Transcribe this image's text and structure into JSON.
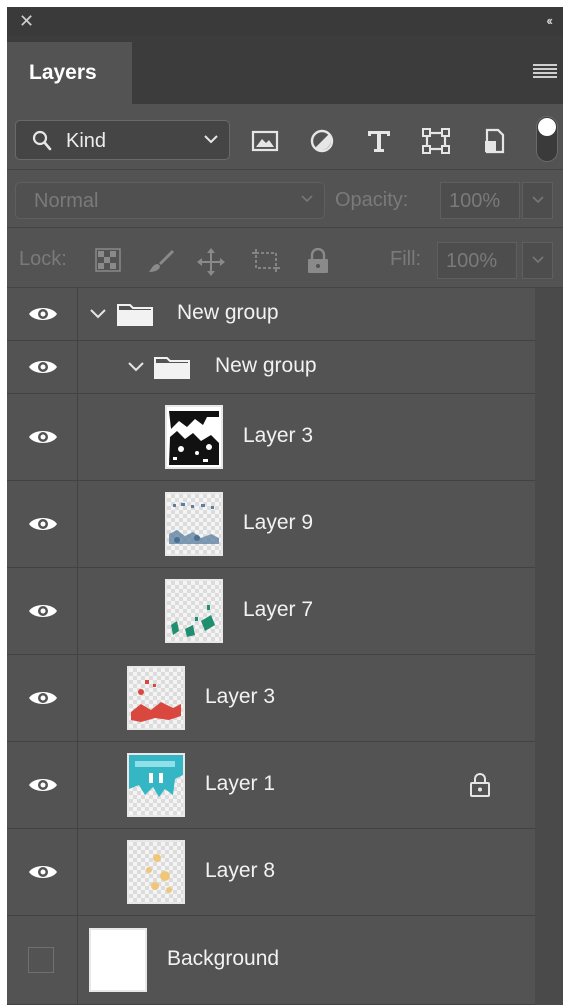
{
  "panel": {
    "title_icons": {
      "close": "close-icon",
      "collapse": "collapse-icon"
    },
    "tab": {
      "label": "Layers"
    },
    "menu_icon": "panel-menu-icon"
  },
  "filter": {
    "kind_label": "Kind",
    "icons": [
      "pixel-layer-filter-icon",
      "adjustment-layer-filter-icon",
      "type-layer-filter-icon",
      "shape-layer-filter-icon",
      "smart-object-filter-icon"
    ],
    "toggle_icon": "filter-toggle-icon"
  },
  "blend": {
    "mode": "Normal",
    "opacity_label": "Opacity:",
    "opacity_value": "100%"
  },
  "lock": {
    "label": "Lock:",
    "icons": [
      "lock-transparent-pixels-icon",
      "lock-image-pixels-icon",
      "lock-position-icon",
      "lock-artboard-icon",
      "lock-all-icon"
    ],
    "fill_label": "Fill:",
    "fill_value": "100%"
  },
  "layers": [
    {
      "name": "New group",
      "type": "group",
      "visible": true,
      "expanded": true
    },
    {
      "name": "New group",
      "type": "group",
      "visible": true,
      "expanded": true
    },
    {
      "name": "Layer 3",
      "type": "pixel",
      "visible": true,
      "thumb_color": "#111111"
    },
    {
      "name": "Layer 9",
      "type": "pixel",
      "visible": true,
      "thumb_color": "#5a7fa0"
    },
    {
      "name": "Layer 7",
      "type": "pixel",
      "visible": true,
      "thumb_color": "#1f8f6f"
    },
    {
      "name": "Layer 3",
      "type": "pixel",
      "visible": true,
      "thumb_color": "#d9473f"
    },
    {
      "name": "Layer 1",
      "type": "pixel",
      "visible": true,
      "thumb_color": "#35b6c4",
      "locked": true
    },
    {
      "name": "Layer 8",
      "type": "pixel",
      "visible": true,
      "thumb_color": "#f0c77a"
    },
    {
      "name": "Background",
      "type": "background",
      "visible": false,
      "thumb_color": "#ffffff"
    }
  ]
}
